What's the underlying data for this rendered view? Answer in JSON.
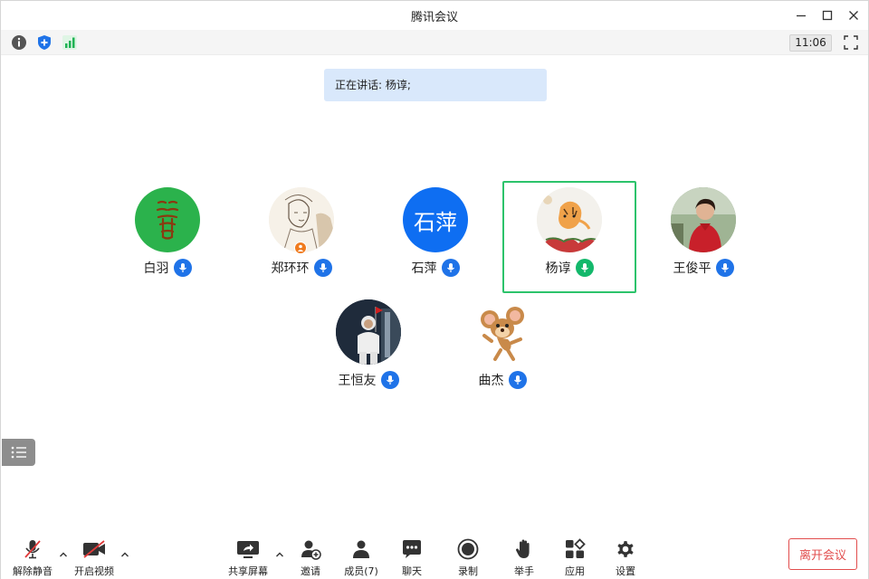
{
  "window": {
    "title": "腾讯会议"
  },
  "status": {
    "clock": "11:06",
    "icons": [
      "info-icon",
      "shield-icon",
      "signal-icon"
    ]
  },
  "speaking": {
    "text": "正在讲话: 杨谆;"
  },
  "participants": [
    {
      "name": "白羽",
      "avatar": "glyph-avatar",
      "avatar_text": "",
      "mic": "unmuted"
    },
    {
      "name": "郑环环",
      "avatar": "sketch-photo",
      "avatar_text": "",
      "mic": "unmuted",
      "badge": "host-icon"
    },
    {
      "name": "石萍",
      "avatar": "text-avatar",
      "avatar_text": "石萍",
      "mic": "unmuted"
    },
    {
      "name": "杨谆",
      "avatar": "tiger-photo",
      "avatar_text": "",
      "mic": "speaking",
      "selected": true
    },
    {
      "name": "王俊平",
      "avatar": "portrait-photo",
      "avatar_text": "",
      "mic": "unmuted"
    },
    {
      "name": "王恒友",
      "avatar": "astronaut-photo",
      "avatar_text": "",
      "mic": "unmuted"
    },
    {
      "name": "曲杰",
      "avatar": "mouse-cartoon",
      "avatar_text": "",
      "mic": "unmuted"
    }
  ],
  "toolbar": {
    "unmute": "解除静音",
    "video": "开启视频",
    "share": "共享屏幕",
    "invite": "邀请",
    "members": "成员(7)",
    "chat": "聊天",
    "record": "录制",
    "raise_hand": "举手",
    "apps": "应用",
    "settings": "设置",
    "leave": "离开会议"
  },
  "colors": {
    "accent": "#1f73e8",
    "speaking_mic": "#13b86b",
    "selected_border": "#2cc36b",
    "leave": "#e24d4d",
    "banner": "#d9e8fb"
  }
}
